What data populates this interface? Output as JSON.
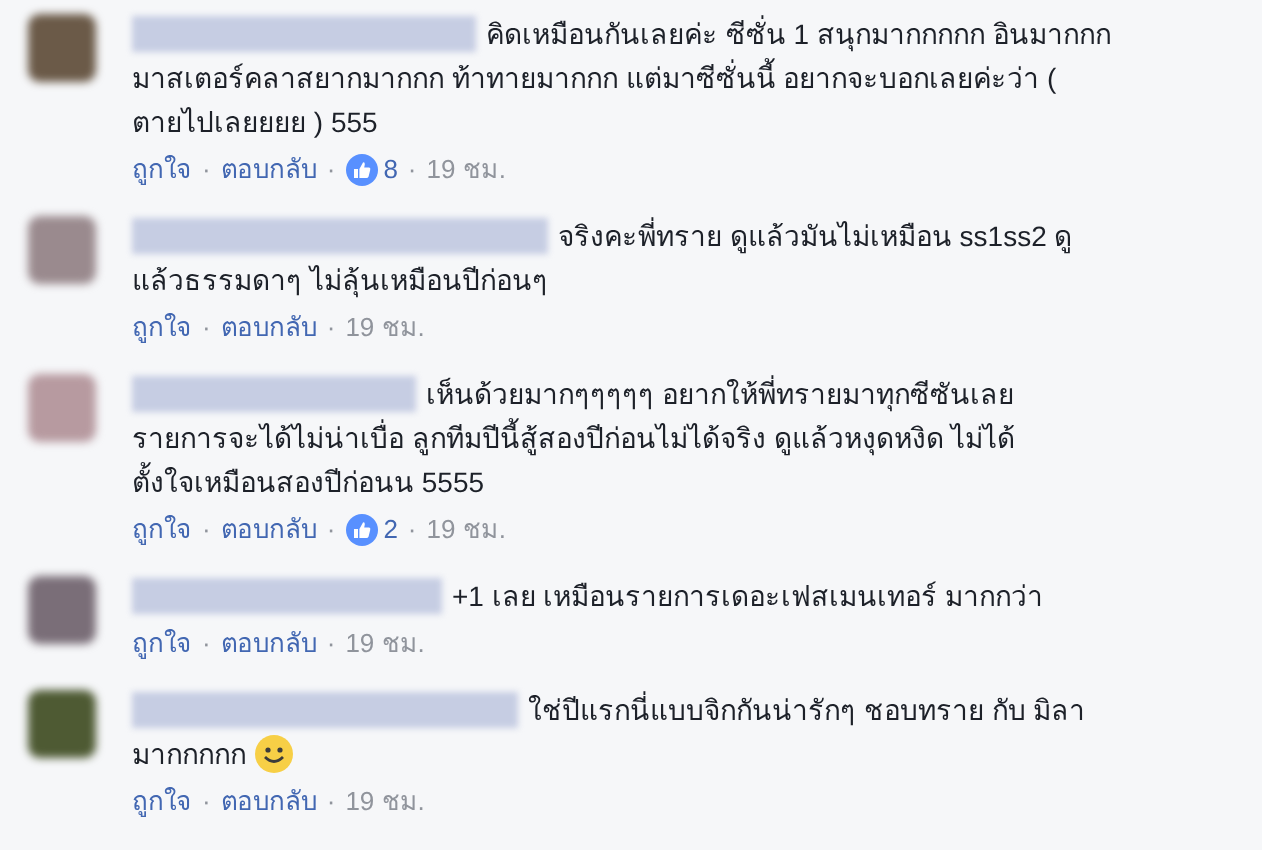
{
  "comments": [
    {
      "lines": [
        "คิดเหมือนกันเลยค่ะ ซีซั่น 1 สนุกมากกกกก อินมากกก",
        "มาสเตอร์คลาสยากมากกก ท้าทายมากกก แต่มาซีซั่นนี้ อยากจะบอกเลยค่ะว่า (",
        "ตายไปเลยยยย ) 555"
      ],
      "smiley": false,
      "like": "ถูกใจ",
      "dot": "·",
      "reply": "ตอบกลับ",
      "likes": "8",
      "time": "19 ชม."
    },
    {
      "lines": [
        "จริงคะพี่ทราย ดูแล้วมันไม่เหมือน ss1ss2 ดู",
        "แล้วธรรมดาๆ ไม่ลุ้นเหมือนปีก่อนๆ"
      ],
      "smiley": false,
      "like": "ถูกใจ",
      "dot": "·",
      "reply": "ตอบกลับ",
      "time": "19 ชม."
    },
    {
      "lines": [
        "เห็นด้วยมากๆๆๆๆๆ อยากให้พี่ทรายมาทุกซีซันเลย",
        "รายการจะได้ไม่น่าเบื่อ ลูกทีมปีนี้สู้สองปีก่อนไม่ได้จริง ดูแล้วหงุดหงิด ไม่ได้",
        "ตั้งใจเหมือนสองปีก่อนน 5555"
      ],
      "smiley": false,
      "like": "ถูกใจ",
      "dot": "·",
      "reply": "ตอบกลับ",
      "likes": "2",
      "time": "19 ชม."
    },
    {
      "lines": [
        "+1 เลย เหมือนรายการเดอะเฟสเมนเทอร์ มากกว่า"
      ],
      "smiley": false,
      "like": "ถูกใจ",
      "dot": "·",
      "reply": "ตอบกลับ",
      "time": "19 ชม."
    },
    {
      "lines": [
        "ใช่ปีแรกนี่แบบจิกกันน่ารักๆ ชอบทราย กับ มิลา",
        "มากกกกก"
      ],
      "smiley": true,
      "like": "ถูกใจ",
      "dot": "·",
      "reply": "ตอบกลับ",
      "time": "19 ชม."
    }
  ]
}
